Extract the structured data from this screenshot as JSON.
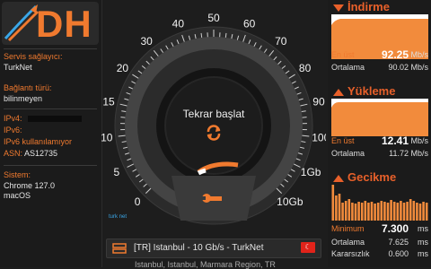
{
  "logo": {
    "text": "DH"
  },
  "info": {
    "isp_label": "Servis sağlayıcı:",
    "isp_value": "TurkNet",
    "conn_label": "Bağlantı türü:",
    "conn_value": "bilinmeyen",
    "ipv4_label": "IPv4:",
    "ipv6_label": "IPv6:",
    "ipv6_value": "IPv6 kullanılamıyor",
    "asn_label": "ASN:",
    "asn_value": "AS12735",
    "system_label": "Sistem:",
    "browser": "Chrome 127.0",
    "os": "macOS"
  },
  "gauge": {
    "ticks": [
      "0",
      "5",
      "10",
      "15",
      "20",
      "30",
      "40",
      "50",
      "60",
      "70",
      "80",
      "90",
      "100",
      "1Gb",
      "10Gb"
    ],
    "button_label": "Tekrar başlat",
    "brand": "turk net"
  },
  "server": {
    "label": "[TR] Istanbul - 10 Gb/s - TurkNet",
    "location": "Istanbul, Istanbul, Marmara Region, TR"
  },
  "download": {
    "title": "İndirme",
    "max_label": "En üst",
    "max_value": "92.25",
    "unit": "Mb/s",
    "avg_label": "Ortalama",
    "avg_value": "90.02"
  },
  "upload": {
    "title": "Yükleme",
    "max_label": "En üst",
    "max_value": "12.41",
    "unit": "Mb/s",
    "avg_label": "Ortalama",
    "avg_value": "11.72"
  },
  "latency": {
    "title": "Gecikme",
    "min_label": "Minimum",
    "min_value": "7.300",
    "unit": "ms",
    "avg_label": "Ortalama",
    "avg_value": "7.625",
    "jitter_label": "Kararsızlık",
    "jitter_value": "0.600"
  },
  "colors": {
    "accent": "#f07a2f",
    "chart_fill": "#f28b3c"
  }
}
